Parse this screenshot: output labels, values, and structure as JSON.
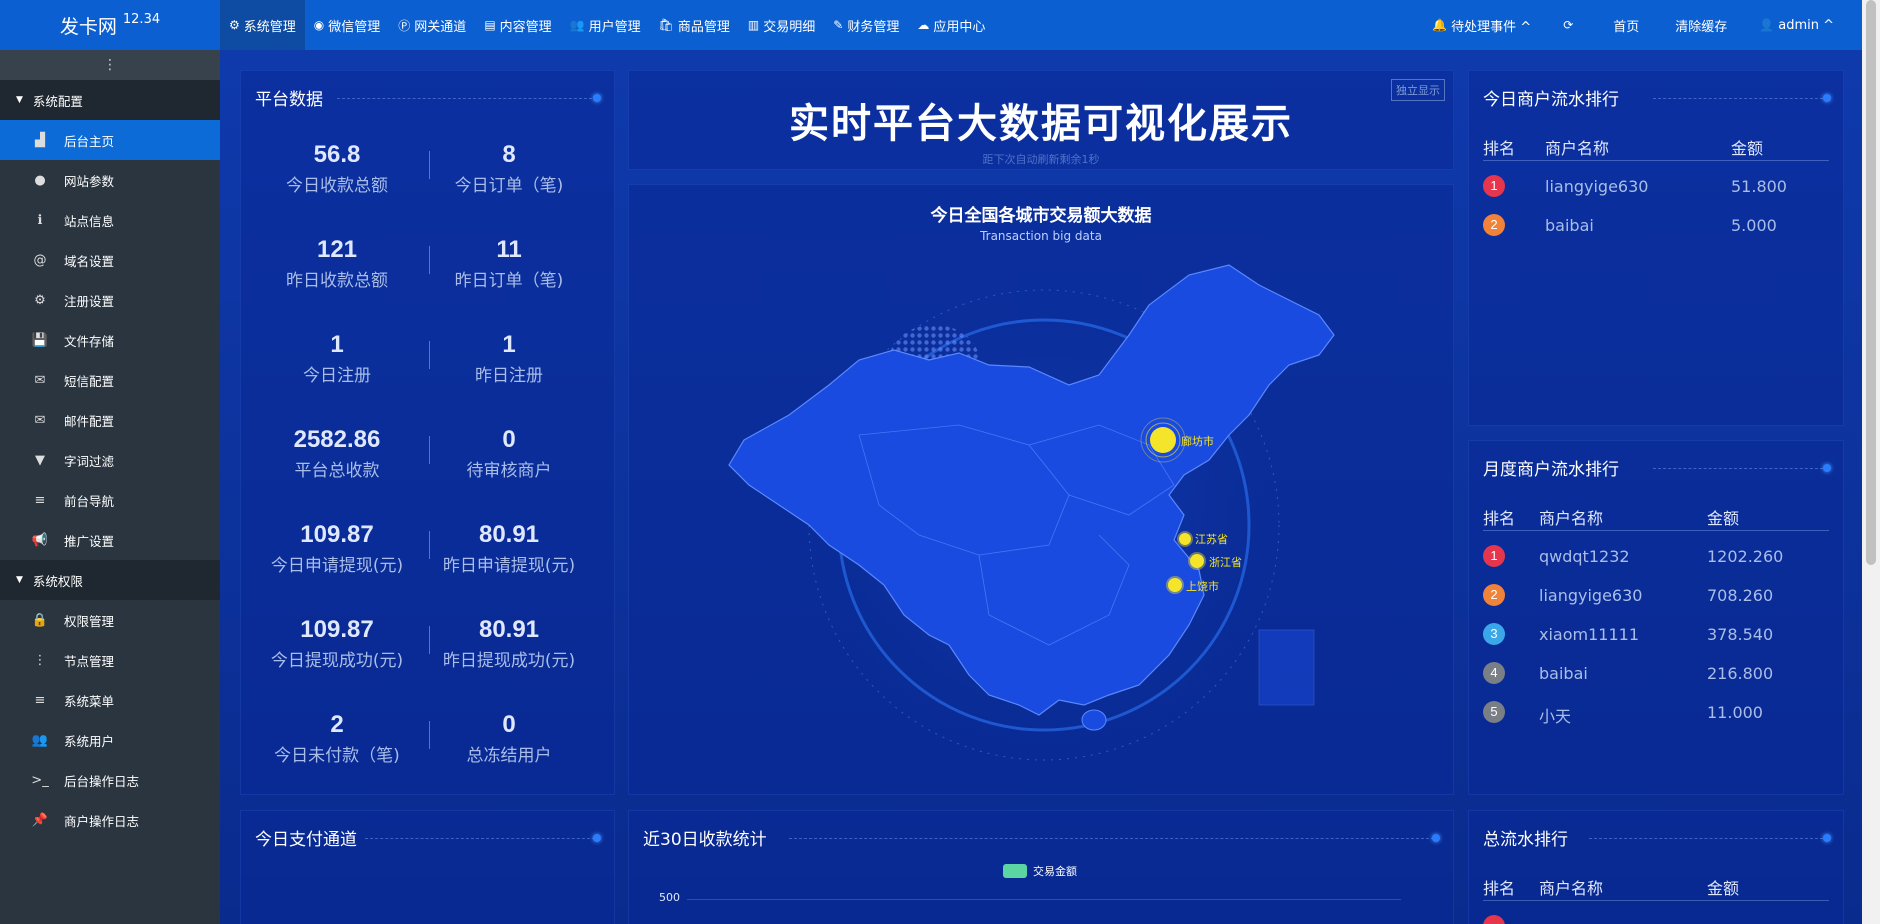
{
  "header": {
    "logo": "发卡网",
    "version": "12.34",
    "nav": [
      {
        "icon": "⚙",
        "label": "系统管理"
      },
      {
        "icon": "◉",
        "label": "微信管理"
      },
      {
        "icon": "Ⓟ",
        "label": "网关通道"
      },
      {
        "icon": "▤",
        "label": "内容管理"
      },
      {
        "icon": "👥",
        "label": "用户管理"
      },
      {
        "icon": "🛍",
        "label": "商品管理"
      },
      {
        "icon": "▥",
        "label": "交易明细"
      },
      {
        "icon": "✎",
        "label": "财务管理"
      },
      {
        "icon": "☁",
        "label": "应用中心"
      }
    ],
    "right": [
      {
        "icon": "🔔",
        "label": "待处理事件 ^"
      },
      {
        "icon": "⟳",
        "label": ""
      },
      {
        "icon": "",
        "label": "首页"
      },
      {
        "icon": "",
        "label": "清除缓存"
      },
      {
        "icon": "👤",
        "label": "admin ^"
      }
    ]
  },
  "sidebar": {
    "toggle": "⋮",
    "groups": [
      {
        "label": "系统配置",
        "items": [
          {
            "icon": "▟",
            "label": "后台主页",
            "active": true
          },
          {
            "icon": "●",
            "label": "网站参数"
          },
          {
            "icon": "ℹ",
            "label": "站点信息"
          },
          {
            "icon": "@",
            "label": "域名设置"
          },
          {
            "icon": "⚙",
            "label": "注册设置"
          },
          {
            "icon": "💾",
            "label": "文件存储"
          },
          {
            "icon": "✉",
            "label": "短信配置"
          },
          {
            "icon": "✉",
            "label": "邮件配置"
          },
          {
            "icon": "▼",
            "label": "字词过滤"
          },
          {
            "icon": "≡",
            "label": "前台导航"
          },
          {
            "icon": "📢",
            "label": "推广设置"
          }
        ]
      },
      {
        "label": "系统权限",
        "items": [
          {
            "icon": "🔒",
            "label": "权限管理"
          },
          {
            "icon": "⋮",
            "label": "节点管理"
          },
          {
            "icon": "≡",
            "label": "系统菜单"
          },
          {
            "icon": "👥",
            "label": "系统用户"
          },
          {
            "icon": ">_",
            "label": "后台操作日志"
          },
          {
            "icon": "📌",
            "label": "商户操作日志"
          }
        ]
      }
    ]
  },
  "platform": {
    "title": "平台数据",
    "stats": [
      {
        "value": "56.8",
        "label": "今日收款总额"
      },
      {
        "value": "8",
        "label": "今日订单（笔)"
      },
      {
        "value": "121",
        "label": "昨日收款总额"
      },
      {
        "value": "11",
        "label": "昨日订单（笔)"
      },
      {
        "value": "1",
        "label": "今日注册"
      },
      {
        "value": "1",
        "label": "昨日注册"
      },
      {
        "value": "2582.86",
        "label": "平台总收款"
      },
      {
        "value": "0",
        "label": "待审核商户"
      },
      {
        "value": "109.87",
        "label": "今日申请提现(元)"
      },
      {
        "value": "80.91",
        "label": "昨日申请提现(元)"
      },
      {
        "value": "109.87",
        "label": "今日提现成功(元)"
      },
      {
        "value": "80.91",
        "label": "昨日提现成功(元)"
      },
      {
        "value": "2",
        "label": "今日未付款（笔)"
      },
      {
        "value": "0",
        "label": "总冻结用户"
      }
    ]
  },
  "hero": {
    "title": "实时平台大数据可视化展示",
    "subtitle": "距下次自动刷新剩余1秒",
    "button": "独立显示"
  },
  "map": {
    "title": "今日全国各城市交易额大数据",
    "subtitle": "Transaction big data",
    "points": [
      {
        "name": "廊坊市"
      },
      {
        "name": "江苏省"
      },
      {
        "name": "浙江省"
      },
      {
        "name": "上饶市"
      }
    ]
  },
  "daily_rank": {
    "title": "今日商户流水排行",
    "columns": [
      "排名",
      "商户名称",
      "金额"
    ],
    "rows": [
      {
        "rank": "1",
        "name": "liangyige630",
        "amount": "51.800"
      },
      {
        "rank": "2",
        "name": "baibai",
        "amount": "5.000"
      }
    ]
  },
  "monthly_rank": {
    "title": "月度商户流水排行",
    "columns": [
      "排名",
      "商户名称",
      "金额"
    ],
    "rows": [
      {
        "rank": "1",
        "name": "qwdqt1232",
        "amount": "1202.260"
      },
      {
        "rank": "2",
        "name": "liangyige630",
        "amount": "708.260"
      },
      {
        "rank": "3",
        "name": "xiaom11111",
        "amount": "378.540"
      },
      {
        "rank": "4",
        "name": "baibai",
        "amount": "216.800"
      },
      {
        "rank": "5",
        "name": "小天",
        "amount": "11.000"
      }
    ]
  },
  "pay_channel": {
    "title": "今日支付通道"
  },
  "thirty_day": {
    "title": "近30日收款统计",
    "legend": "交易金额",
    "ytick": "500"
  },
  "total_rank": {
    "title": "总流水排行",
    "columns": [
      "排名",
      "商户名称",
      "金额"
    ]
  },
  "colors": {
    "rank1": "#e5364d",
    "rank2": "#f0823a",
    "rank3": "#3aa8e8",
    "rank4": "#7a7f86",
    "rank5": "#7a7f86",
    "accent": "#0c5fd0",
    "legend": "#5bd6a2",
    "point": "#f5e52a"
  }
}
